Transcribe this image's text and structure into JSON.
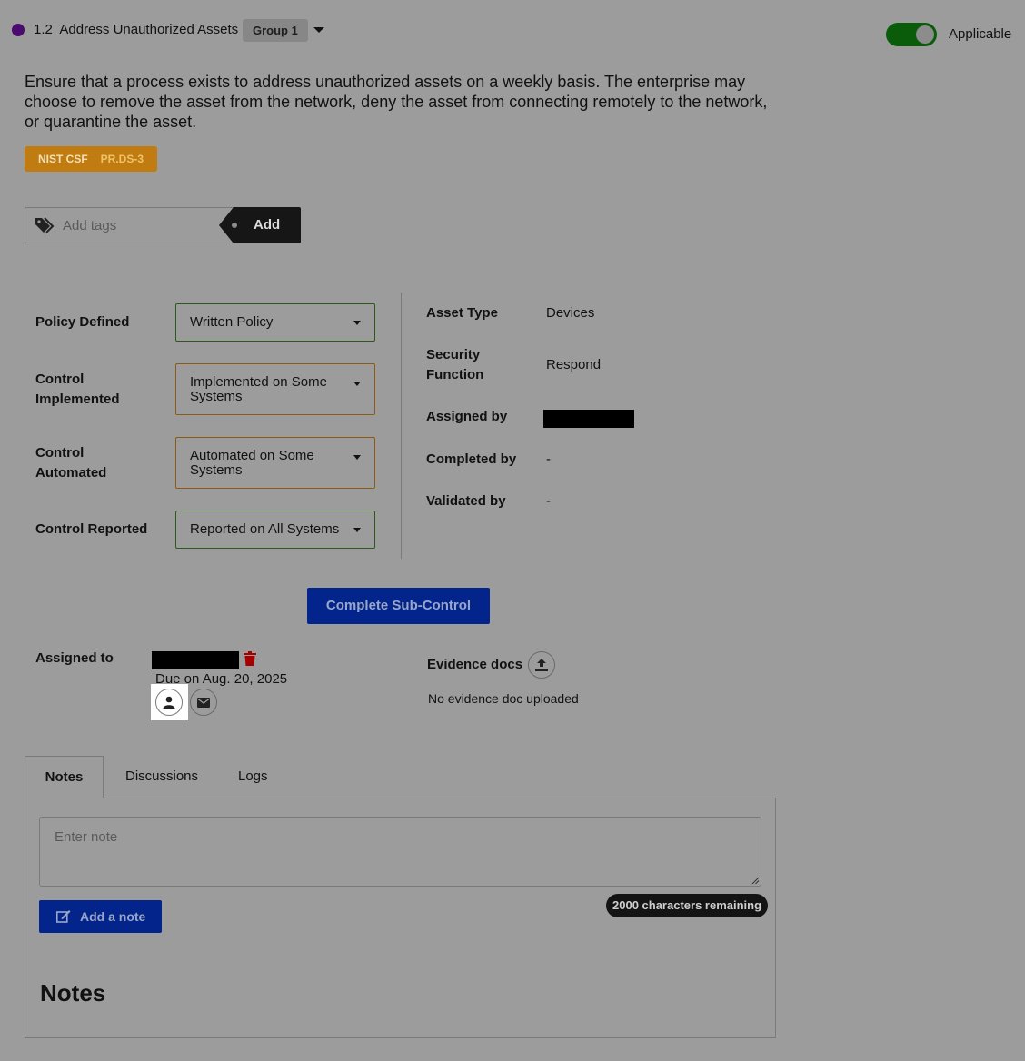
{
  "header": {
    "number": "1.2",
    "title": "Address Unauthorized Assets",
    "group_badge": "Group 1",
    "applicable_label": "Applicable",
    "applicable_on": true,
    "dot_color": "#4a0a6e"
  },
  "description": "Ensure that a process exists to address unauthorized assets on a weekly basis. The enterprise may choose to remove the asset from the network, deny the asset from connecting remotely to the network, or quarantine the asset.",
  "framework_badge": {
    "framework": "NIST CSF",
    "code": "PR.DS-3",
    "color": "#c07c10"
  },
  "tags": {
    "placeholder": "Add tags",
    "add_label": "Add"
  },
  "controls": [
    {
      "label": "Policy Defined",
      "value": "Written Policy",
      "status": "green"
    },
    {
      "label": "Control Implemented",
      "value": "Implemented on Some Systems",
      "status": "orange"
    },
    {
      "label": "Control Automated",
      "value": "Automated on Some Systems",
      "status": "orange"
    },
    {
      "label": "Control Reported",
      "value": "Reported on All Systems",
      "status": "green"
    }
  ],
  "info": [
    {
      "label": "Asset Type",
      "value": "Devices"
    },
    {
      "label": "Security Function",
      "value": "Respond"
    },
    {
      "label": "Assigned by",
      "value": ""
    },
    {
      "label": "Completed by",
      "value": "-"
    },
    {
      "label": "Validated by",
      "value": "-"
    }
  ],
  "complete_button": "Complete Sub-Control",
  "assignment": {
    "label": "Assigned to",
    "due": "Due on Aug. 20, 2025"
  },
  "evidence": {
    "label": "Evidence docs",
    "empty_text": "No evidence doc uploaded"
  },
  "tabs": [
    "Notes",
    "Discussions",
    "Logs"
  ],
  "notes": {
    "placeholder": "Enter note",
    "char_count": "2000 characters remaining",
    "add_label": "Add a note",
    "heading": "Notes"
  },
  "colors": {
    "primary": "#03248a",
    "success": "#0a5c0a",
    "danger": "#a40000"
  }
}
